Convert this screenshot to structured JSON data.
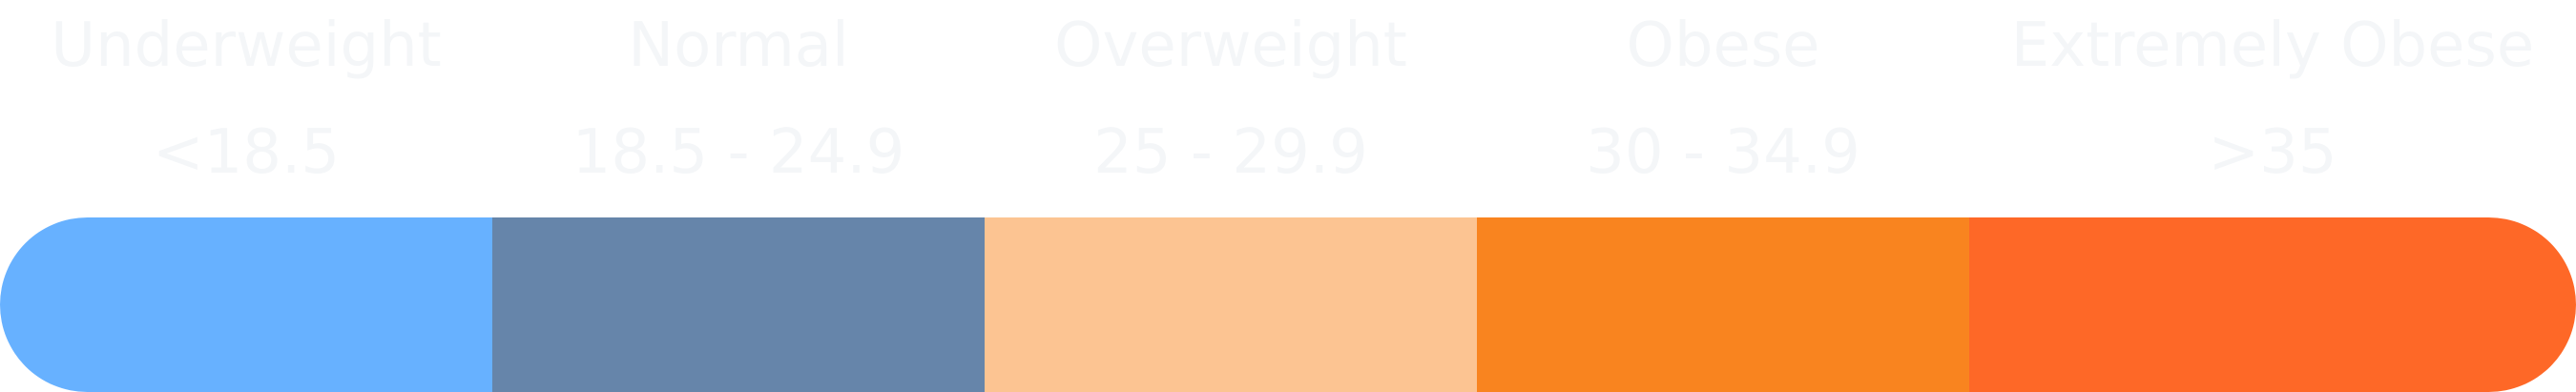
{
  "categories": [
    {
      "name": "Underweight",
      "range": "<18.5",
      "color": "#67b1ff"
    },
    {
      "name": "Normal",
      "range": "18.5 - 24.9",
      "color": "#6685aa"
    },
    {
      "name": "Overweight",
      "range": "25 - 29.9",
      "color": "#fcc492"
    },
    {
      "name": "Obese",
      "range": "30 - 34.9",
      "color": "#f9841f"
    },
    {
      "name": "Extremely Obese",
      "range": ">35",
      "color": "#fe6827"
    }
  ]
}
